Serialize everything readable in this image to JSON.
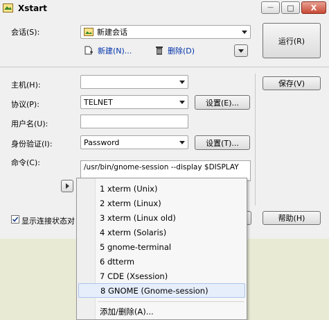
{
  "window": {
    "title": "Xstart",
    "icon": "xstart-app-icon",
    "minimize_glyph": "—",
    "maximize_glyph": "□",
    "close_glyph": "X"
  },
  "session": {
    "label": "会话(S):",
    "selected": "新建会话",
    "new_label": "新建(N)...",
    "delete_label": "删除(D)",
    "run_label": "运行(R)"
  },
  "form": {
    "host_label": "主机(H):",
    "host_value": "",
    "protocol_label": "协议(P):",
    "protocol_value": "TELNET",
    "protocol_settings_label": "设置(E)...",
    "username_label": "用户名(U):",
    "username_value": "",
    "auth_label": "身份验证(I):",
    "auth_value": "Password",
    "auth_settings_label": "设置(T)...",
    "command_label": "命令(C):",
    "command_value": "/usr/bin/gnome-session --display $DISPLAY",
    "save_label": "保存(V)",
    "help_label": "帮助(H)",
    "show_status_label": "显示连接状态对",
    "show_status_checked": true
  },
  "command_menu": {
    "items": [
      "1 xterm (Unix)",
      "2 xterm (Linux)",
      "3 xterm (Linux old)",
      "4 xterm (Solaris)",
      "5 gnome-terminal",
      "6 dtterm",
      "7 CDE (Xsession)",
      "8 GNOME (Gnome-session)"
    ],
    "highlighted_index": 7,
    "add_delete_label": "添加/删除(A)..."
  }
}
